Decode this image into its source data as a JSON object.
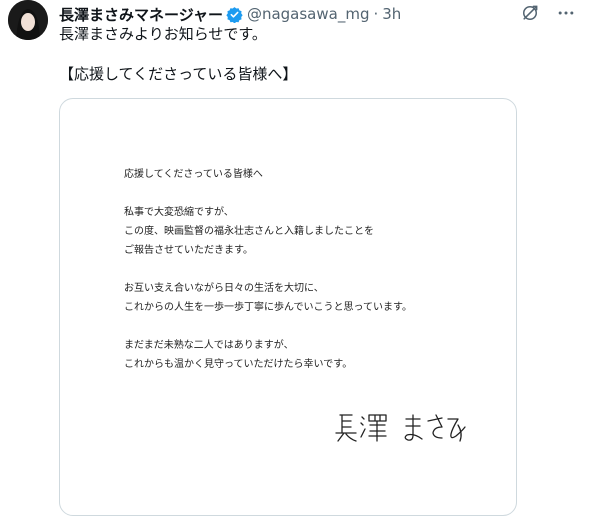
{
  "tweet": {
    "display_name": "長澤まさみマネージャー",
    "handle": "@nagasawa_mg",
    "separator": "·",
    "time": "3h",
    "text_lines": [
      "長澤まさみよりお知らせです。",
      "",
      "【応援してくださっている皆様へ】"
    ]
  },
  "letter": {
    "greeting": "応援してくださっている皆様へ",
    "paragraph1": [
      "私事で大変恐縮ですが、",
      "この度、映画監督の福永壮志さんと入籍しましたことを",
      "ご報告させていただきます。"
    ],
    "paragraph2": [
      "お互い支え合いながら日々の生活を大切に、",
      "これからの人生を一歩一歩丁寧に歩んでいこうと思っています。"
    ],
    "paragraph3": [
      "まだまだ未熟な二人ではありますが、",
      "これからも温かく見守っていただけたら幸いです。"
    ],
    "signature": "長澤 まさみ"
  },
  "colors": {
    "verified": "#1d9bf0",
    "secondary_text": "#536471",
    "border": "#cfd9de"
  },
  "icons": {
    "verified": "verified-badge-icon",
    "grok": "grok-icon",
    "more": "more-icon"
  }
}
